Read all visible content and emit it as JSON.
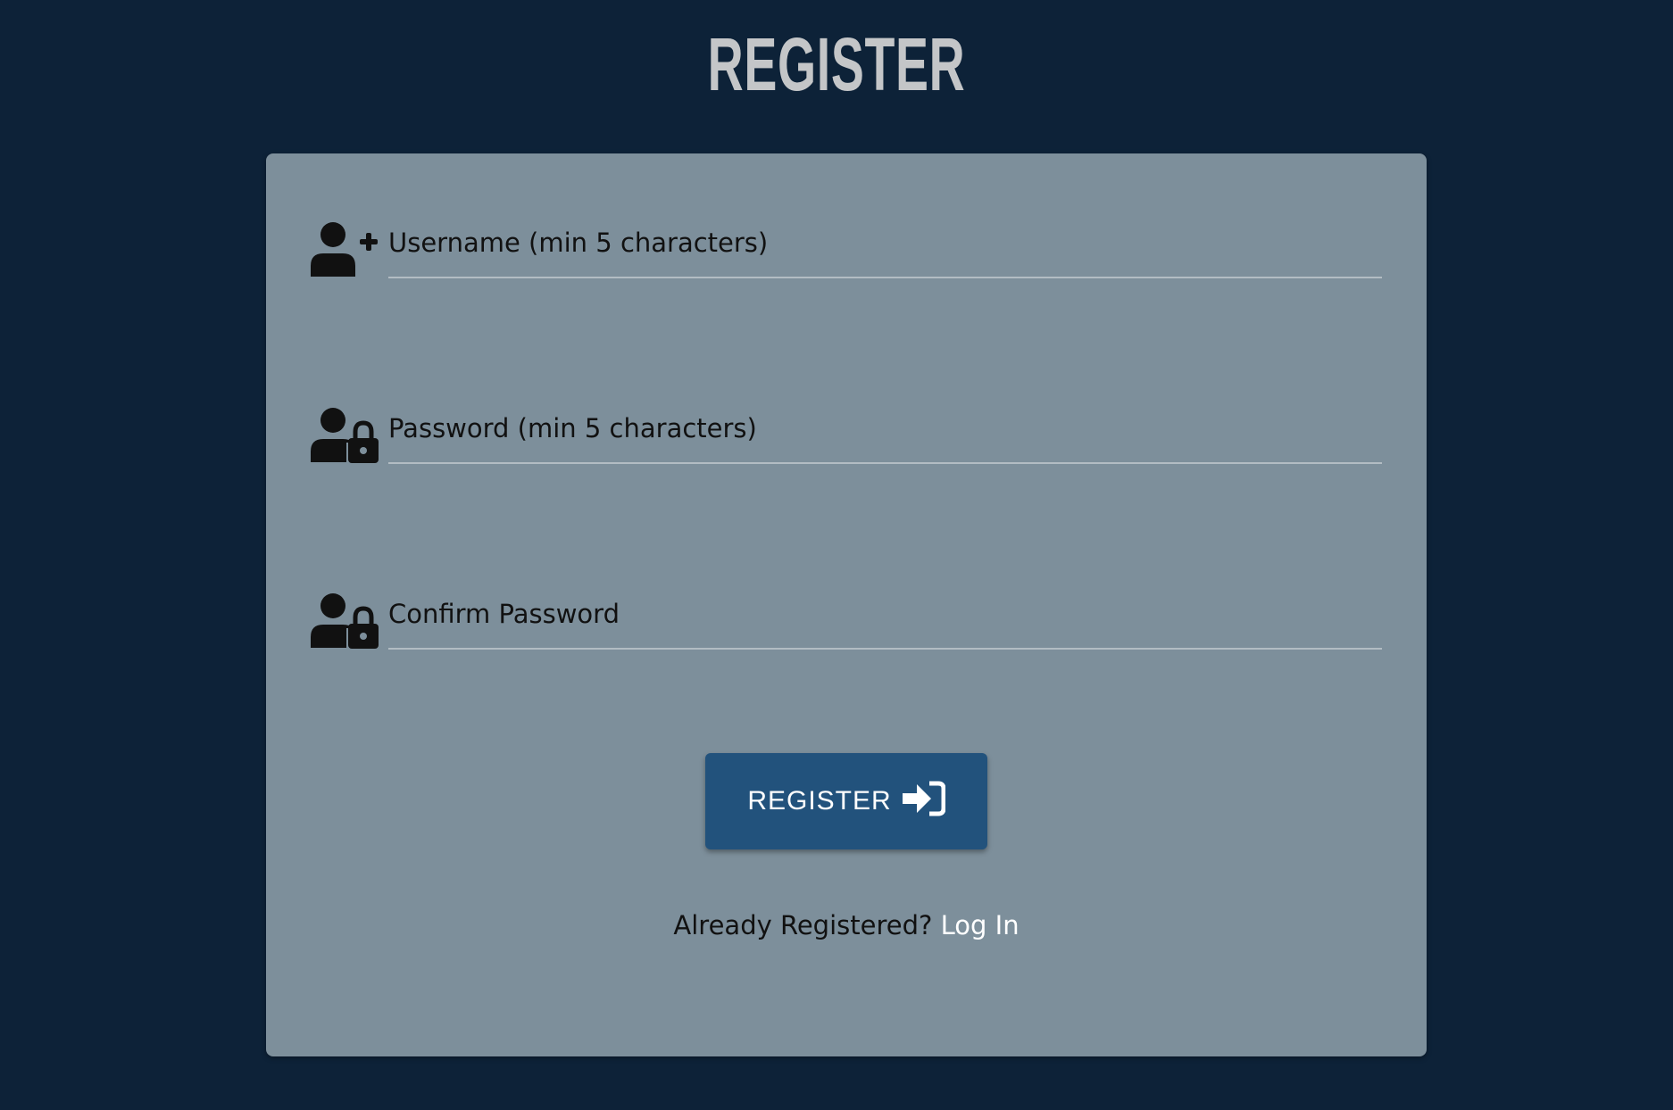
{
  "page": {
    "title": "REGISTER"
  },
  "form": {
    "fields": [
      {
        "icon": "user-plus-icon",
        "placeholder": "Username (min 5 characters)",
        "value": ""
      },
      {
        "icon": "user-lock-icon",
        "placeholder": "Password (min 5 characters)",
        "value": ""
      },
      {
        "icon": "user-lock-icon",
        "placeholder": "Confirm Password",
        "value": ""
      }
    ],
    "submit_label": "REGISTER",
    "submit_icon": "sign-in-icon"
  },
  "footer": {
    "prompt": "Already Registered?",
    "link_label": "Log In"
  },
  "colors": {
    "background": "#0d2238",
    "card": "#7d8f9b",
    "button": "#22527c",
    "title": "#c4c6c8",
    "link": "#ffffff"
  }
}
